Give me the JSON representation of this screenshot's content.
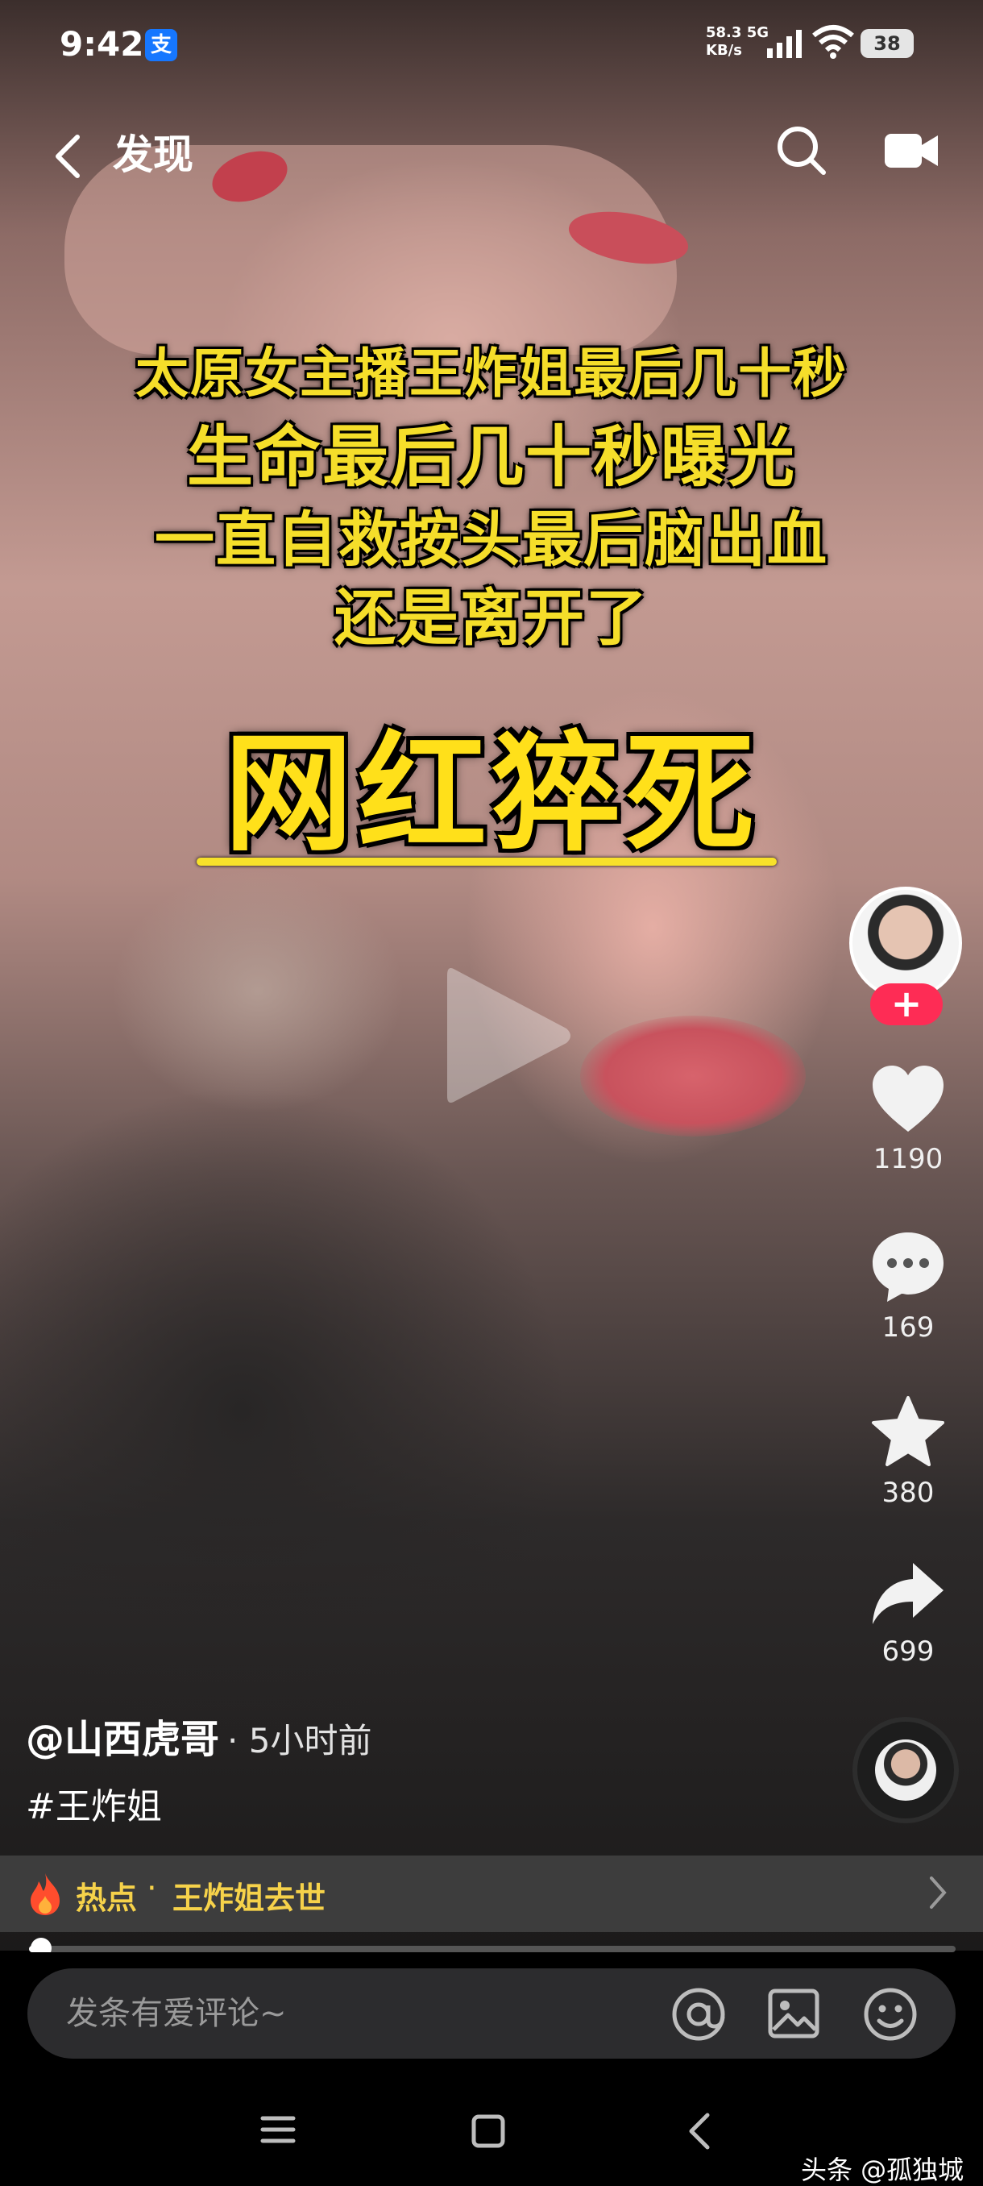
{
  "status_bar": {
    "time": "9:42",
    "alipay_badge": "支",
    "net_speed_value": "58.3",
    "net_type": "5G",
    "net_unit": "KB/s",
    "battery": "38"
  },
  "top_nav": {
    "title": "发现"
  },
  "overlay": {
    "line1": "太原女主播王炸姐最后几十秒",
    "line2": "生命最后几十秒曝光",
    "line3": "一直自救按头最后脑出血",
    "line4": "还是离开了",
    "headline": "网红猝死"
  },
  "actions": {
    "follow_symbol": "+",
    "likes": "1190",
    "comments": "169",
    "favorites": "380",
    "shares": "699"
  },
  "post": {
    "author": "@山西虎哥",
    "time_ago": "· 5小时前",
    "hashtag": "#王炸姐"
  },
  "hot_bar": {
    "label": "热点",
    "separator": "·",
    "topic": "王炸姐去世"
  },
  "progress": {
    "fraction": 0.013
  },
  "comment_bar": {
    "placeholder": "发条有爱评论~"
  },
  "watermark": "头条 @孤独城",
  "colors": {
    "accent_follow": "#fe2c55",
    "overlay_text": "#f5de2a",
    "hot_text": "#f6d24a"
  },
  "icons": [
    "back-icon",
    "search-icon",
    "camera-icon",
    "play-icon",
    "heart-icon",
    "comment-icon",
    "star-icon",
    "share-icon",
    "fire-icon",
    "chevron-right-icon",
    "at-icon",
    "image-icon",
    "emoji-icon",
    "menu-icon",
    "home-icon",
    "sys-back-icon"
  ]
}
